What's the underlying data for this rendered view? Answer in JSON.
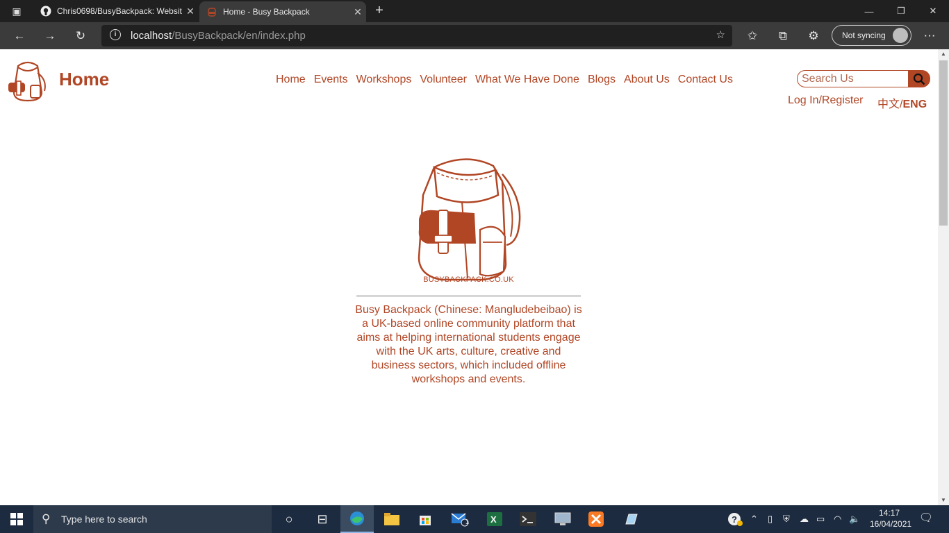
{
  "browser": {
    "tabs": [
      {
        "title": "Chris0698/BusyBackpack: Websit",
        "close": "✕"
      },
      {
        "title": "Home - Busy Backpack",
        "close": "✕"
      }
    ],
    "new_tab": "+",
    "window_controls": {
      "minimize": "—",
      "restore": "❐",
      "close": "✕"
    },
    "address": {
      "host": "localhost",
      "path": "/BusyBackpack/en/index.php"
    },
    "profile_label": "Not syncing",
    "icons": [
      "back-icon",
      "forward-icon",
      "refresh-icon",
      "site-info-icon",
      "add-favorite-icon",
      "favorites-icon",
      "collections-icon",
      "extensions-icon",
      "more-icon"
    ]
  },
  "site": {
    "page_title": "Home",
    "nav": [
      "Home",
      "Events",
      "Workshops",
      "Volunteer",
      "What We Have Done",
      "Blogs",
      "About Us",
      "Contact Us"
    ],
    "search": {
      "placeholder": "Search Us"
    },
    "login": "Log In/Register",
    "lang": {
      "zh": "中文",
      "sep": "/",
      "en": "ENG"
    },
    "logo_caption": "BUSYBACKPACK.CO.UK",
    "about": "Busy Backpack (Chinese: Mangludebeibao) is a UK-based online community platform that aims at helping international students engage with the UK arts, culture, creative and business sectors, which included offline workshops and events.",
    "brand_color": "#b14625"
  },
  "taskbar": {
    "search_placeholder": "Type here to search",
    "mail_badge": "1",
    "time": "14:17",
    "date": "16/04/2021",
    "apps": [
      "cortana-icon",
      "task-view-icon",
      "edge-dev-icon",
      "file-explorer-icon",
      "store-icon",
      "mail-icon",
      "excel-icon",
      "terminal-icon",
      "remote-desktop-icon",
      "xampp-icon",
      "notepad-icon"
    ]
  }
}
